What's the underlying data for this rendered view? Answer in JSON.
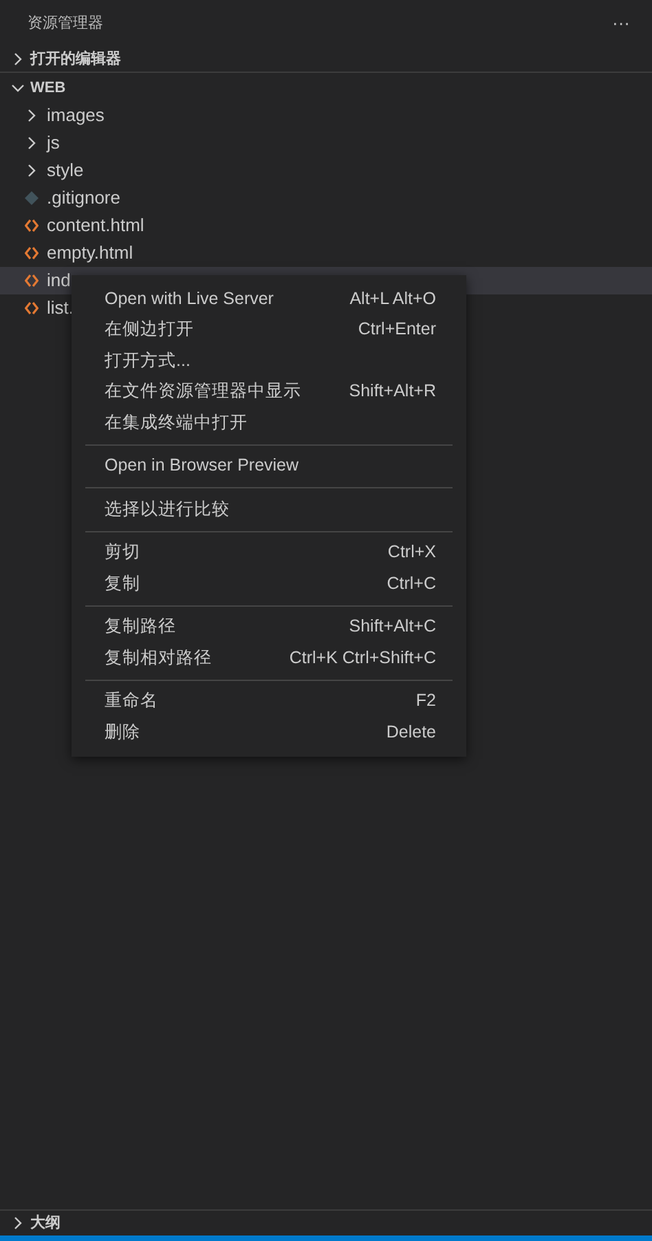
{
  "header": {
    "title": "资源管理器",
    "more": "···"
  },
  "sections": [
    {
      "label": "打开的编辑器",
      "expanded": false
    }
  ],
  "workspace": {
    "label": "WEB",
    "expanded": true,
    "items": [
      {
        "kind": "folder",
        "label": "images",
        "selected": false
      },
      {
        "kind": "folder",
        "label": "js",
        "selected": false
      },
      {
        "kind": "folder",
        "label": "style",
        "selected": false
      },
      {
        "kind": "git",
        "label": ".gitignore",
        "selected": false
      },
      {
        "kind": "html",
        "label": "content.html",
        "selected": false
      },
      {
        "kind": "html",
        "label": "empty.html",
        "selected": false
      },
      {
        "kind": "html",
        "label": "ind",
        "selected": true
      },
      {
        "kind": "html",
        "label": "list.",
        "selected": false
      }
    ]
  },
  "context_menu": {
    "groups": [
      [
        {
          "label": "Open with Live Server",
          "shortcut": "Alt+L Alt+O"
        },
        {
          "label": "在侧边打开",
          "shortcut": "Ctrl+Enter"
        },
        {
          "label": "打开方式..."
        },
        {
          "label": "在文件资源管理器中显示",
          "shortcut": "Shift+Alt+R"
        },
        {
          "label": "在集成终端中打开"
        }
      ],
      [
        {
          "label": "Open in Browser Preview"
        }
      ],
      [
        {
          "label": "选择以进行比较"
        }
      ],
      [
        {
          "label": "剪切",
          "shortcut": "Ctrl+X"
        },
        {
          "label": "复制",
          "shortcut": "Ctrl+C"
        }
      ],
      [
        {
          "label": "复制路径",
          "shortcut": "Shift+Alt+C"
        },
        {
          "label": "复制相对路径",
          "shortcut": "Ctrl+K Ctrl+Shift+C"
        }
      ],
      [
        {
          "label": "重命名",
          "shortcut": "F2"
        },
        {
          "label": "删除",
          "shortcut": "Delete"
        }
      ]
    ]
  },
  "outline": {
    "label": "大纲",
    "expanded": false
  }
}
